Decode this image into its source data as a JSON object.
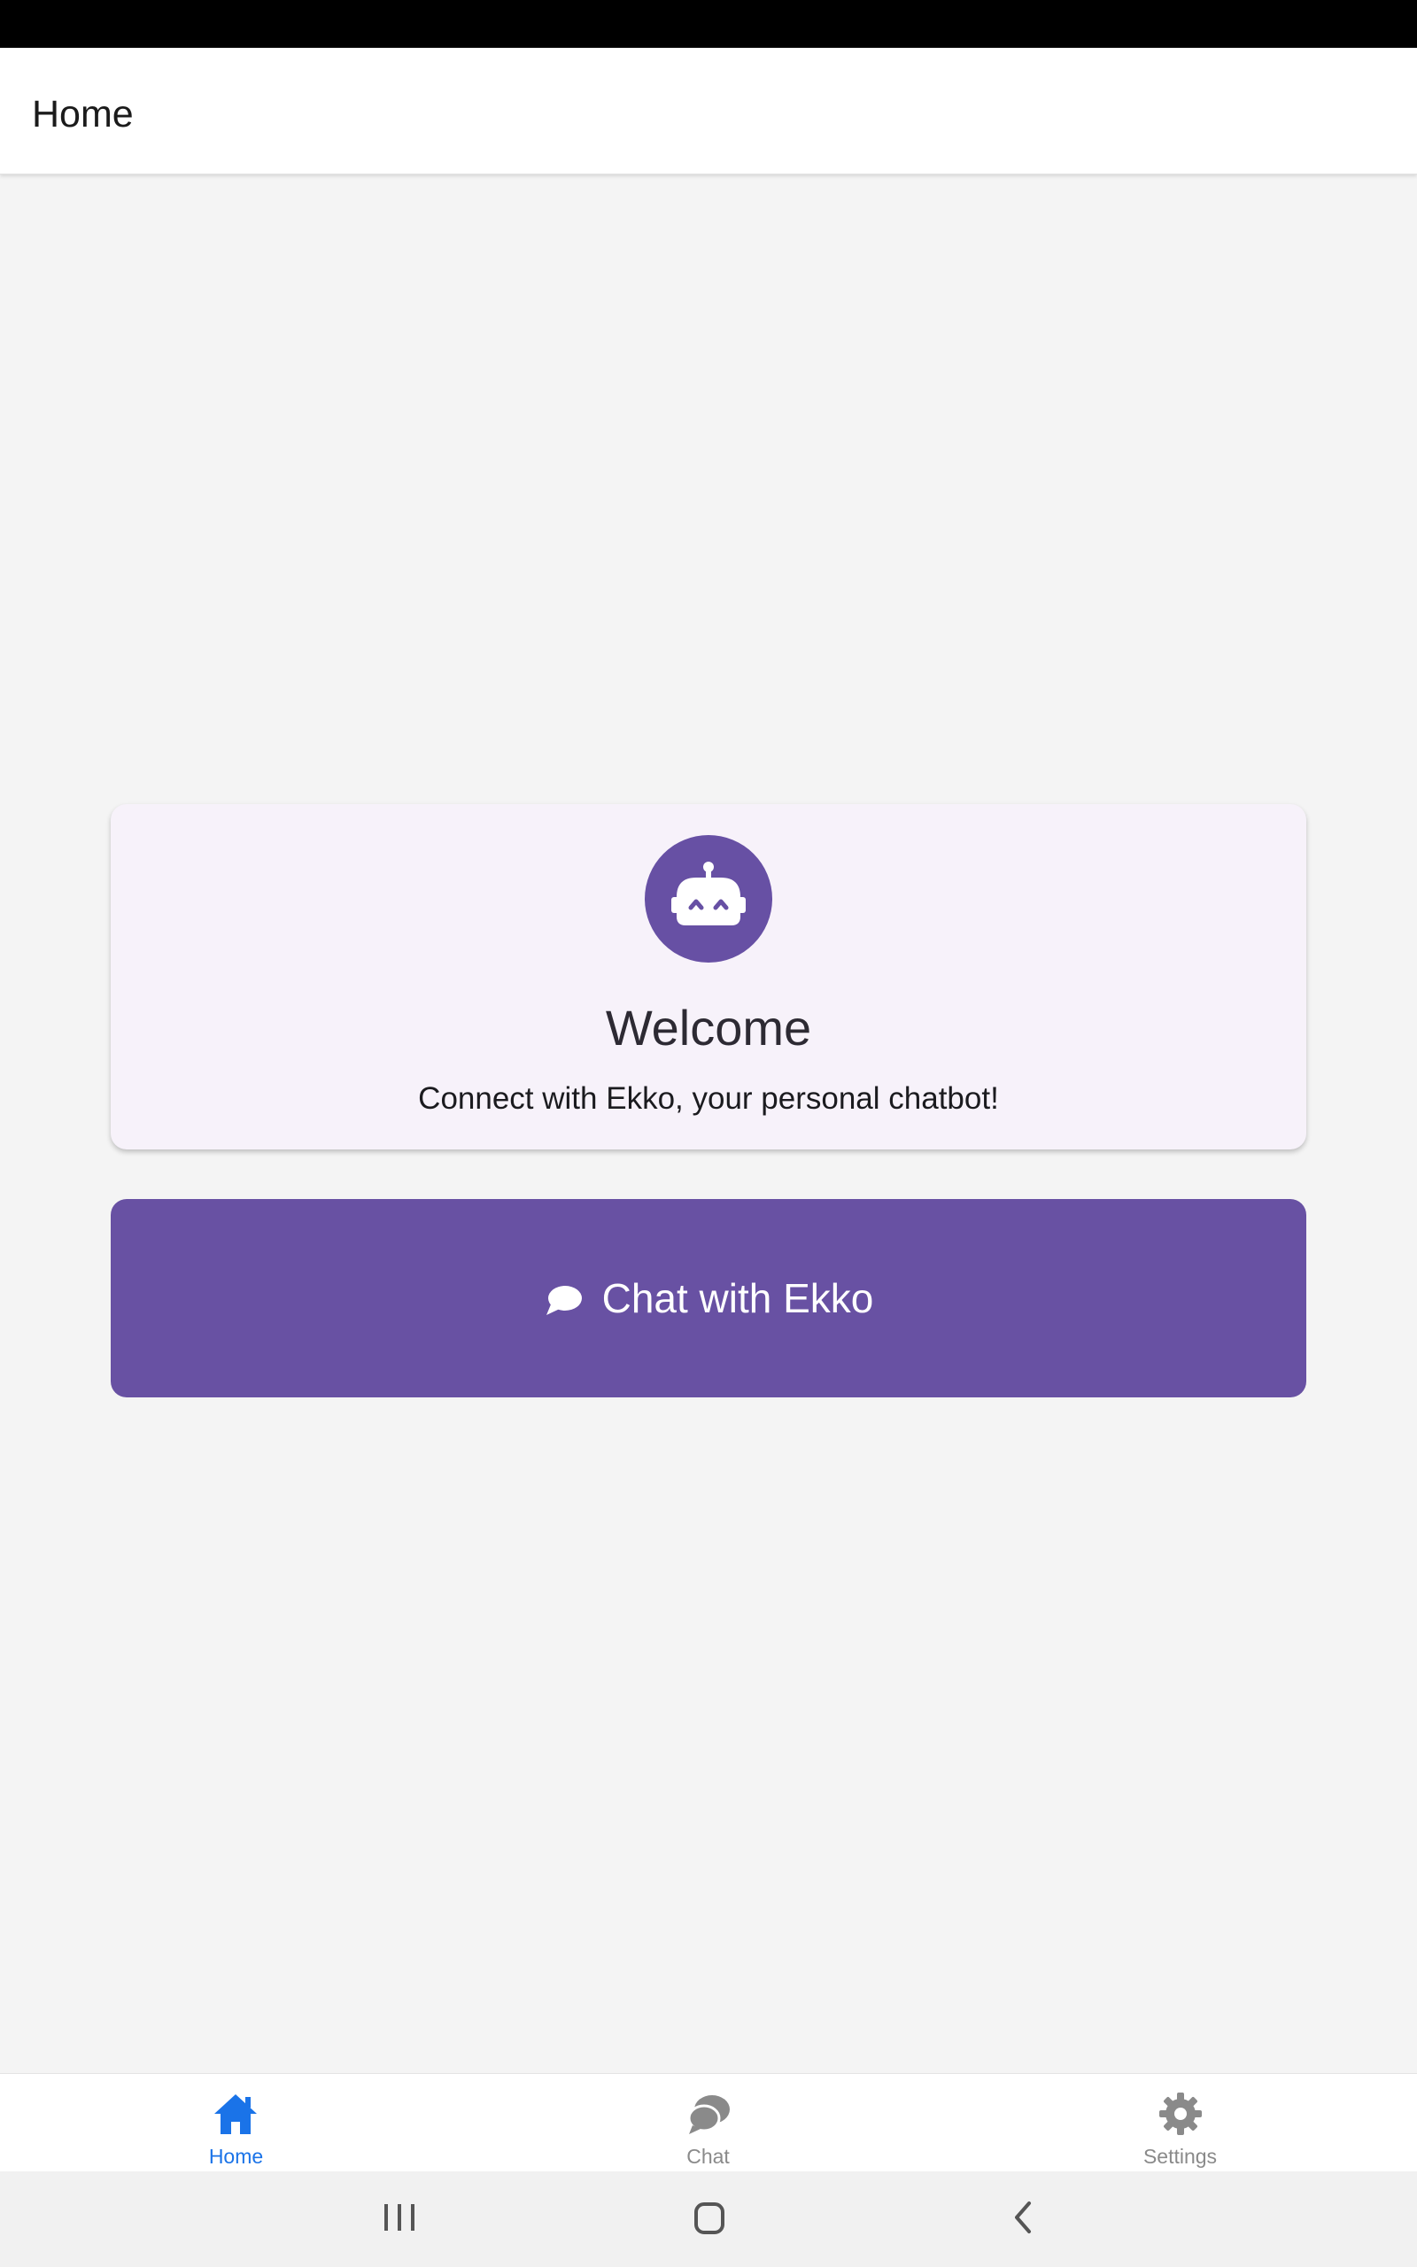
{
  "header": {
    "title": "Home"
  },
  "welcome_card": {
    "avatar_icon": "robot-icon",
    "title": "Welcome",
    "subtitle": "Connect with Ekko, your personal chatbot!"
  },
  "chat_button": {
    "icon": "chat-bubble-icon",
    "label": "Chat with Ekko"
  },
  "bottom_nav": {
    "items": [
      {
        "label": "Home",
        "icon": "home-icon",
        "active": true
      },
      {
        "label": "Chat",
        "icon": "chat-icon",
        "active": false
      },
      {
        "label": "Settings",
        "icon": "gear-icon",
        "active": false
      }
    ]
  },
  "system_nav": {
    "buttons": [
      "recent-apps-icon",
      "home-circle-icon",
      "back-icon"
    ]
  },
  "colors": {
    "accent": "#6851a3",
    "card_background": "#f7f2fa",
    "page_background": "#f4f4f4",
    "nav_active": "#1a73e8",
    "nav_inactive": "#8a8a8a"
  }
}
